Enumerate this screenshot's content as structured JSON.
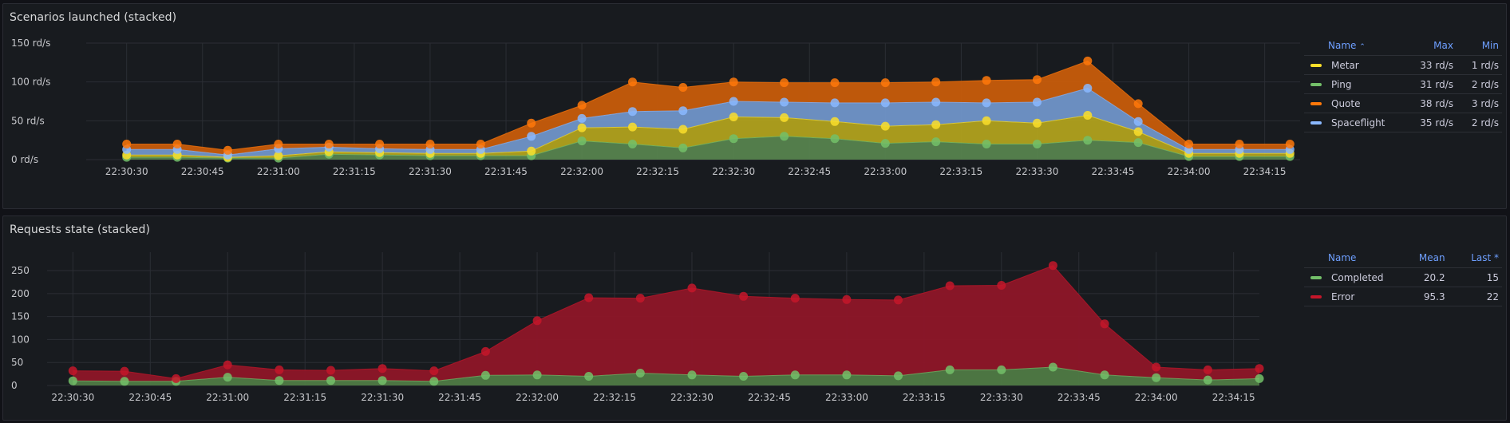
{
  "panel1": {
    "title": "Scenarios launched (stacked)",
    "legend": {
      "headers": [
        "Name",
        "Max",
        "Min"
      ],
      "sort_indicator": "⌃",
      "rows": [
        {
          "name": "Metar",
          "color": "#fade2a",
          "max": "33 rd/s",
          "min": "1 rd/s"
        },
        {
          "name": "Ping",
          "color": "#73bf69",
          "max": "31 rd/s",
          "min": "2 rd/s"
        },
        {
          "name": "Quote",
          "color": "#ff780a",
          "max": "38 rd/s",
          "min": "3 rd/s"
        },
        {
          "name": "Spaceflight",
          "color": "#8ab8ff",
          "max": "35 rd/s",
          "min": "2 rd/s"
        }
      ]
    }
  },
  "panel2": {
    "title": "Requests state (stacked)",
    "legend": {
      "headers": [
        "Name",
        "Mean",
        "Last *"
      ],
      "rows": [
        {
          "name": "Completed",
          "color": "#73bf69",
          "mean": "20.2",
          "last": "15"
        },
        {
          "name": "Error",
          "color": "#c4162a",
          "mean": "95.3",
          "last": "22"
        }
      ]
    }
  },
  "chart_data": [
    {
      "type": "area",
      "stacked": true,
      "title": "Scenarios launched (stacked)",
      "x_labels": [
        "22:30:30",
        "22:30:45",
        "22:31:00",
        "22:31:15",
        "22:31:30",
        "22:31:45",
        "22:32:00",
        "22:32:15",
        "22:32:30",
        "22:32:45",
        "22:33:00",
        "22:33:15",
        "22:33:30",
        "22:33:45",
        "22:34:00",
        "22:34:15"
      ],
      "ylim": [
        0,
        150
      ],
      "y_ticks": [
        0,
        50,
        100,
        150
      ],
      "y_tick_labels": [
        "0 rd/s",
        "50 rd/s",
        "100 rd/s",
        "150 rd/s"
      ],
      "x": [
        "22:30:30",
        "22:30:40",
        "22:30:50",
        "22:31:00",
        "22:31:10",
        "22:31:20",
        "22:31:30",
        "22:31:40",
        "22:31:50",
        "22:32:00",
        "22:32:10",
        "22:32:20",
        "22:32:30",
        "22:32:40",
        "22:32:50",
        "22:33:00",
        "22:33:10",
        "22:33:20",
        "22:33:30",
        "22:33:40",
        "22:33:50",
        "22:34:00",
        "22:34:10",
        "22:34:20"
      ],
      "series": [
        {
          "name": "Ping",
          "color": "#73bf69",
          "fill": "#56834e",
          "values": [
            3,
            3,
            2,
            2,
            7,
            6,
            5,
            5,
            5,
            24,
            20,
            15,
            27,
            30,
            27,
            21,
            23,
            20,
            20,
            25,
            22,
            4,
            4,
            4
          ]
        },
        {
          "name": "Metar",
          "color": "#fade2a",
          "fill": "#b0a11e",
          "values": [
            3,
            3,
            1,
            3,
            3,
            3,
            3,
            3,
            6,
            17,
            22,
            24,
            28,
            24,
            22,
            22,
            22,
            30,
            27,
            32,
            14,
            4,
            4,
            4
          ]
        },
        {
          "name": "Spaceflight",
          "color": "#8ab8ff",
          "fill": "#7095c9",
          "values": [
            7,
            7,
            3,
            9,
            6,
            5,
            5,
            5,
            19,
            12,
            20,
            24,
            20,
            20,
            24,
            30,
            29,
            23,
            27,
            35,
            13,
            5,
            5,
            5
          ]
        },
        {
          "name": "Quote",
          "color": "#ff780a",
          "fill": "#c75c0b",
          "values": [
            7,
            7,
            6,
            6,
            4,
            6,
            7,
            7,
            17,
            17,
            38,
            30,
            25,
            25,
            26,
            26,
            26,
            29,
            29,
            35,
            23,
            7,
            7,
            7
          ]
        }
      ]
    },
    {
      "type": "area",
      "stacked": true,
      "title": "Requests state (stacked)",
      "x_labels": [
        "22:30:30",
        "22:30:45",
        "22:31:00",
        "22:31:15",
        "22:31:30",
        "22:31:45",
        "22:32:00",
        "22:32:15",
        "22:32:30",
        "22:32:45",
        "22:33:00",
        "22:33:15",
        "22:33:30",
        "22:33:45",
        "22:34:00",
        "22:34:15"
      ],
      "ylim": [
        0,
        290
      ],
      "y_ticks": [
        0,
        50,
        100,
        150,
        200,
        250
      ],
      "y_tick_labels": [
        "0",
        "50",
        "100",
        "150",
        "200",
        "250"
      ],
      "x": [
        "22:30:30",
        "22:30:40",
        "22:30:50",
        "22:31:00",
        "22:31:10",
        "22:31:20",
        "22:31:30",
        "22:31:40",
        "22:31:50",
        "22:32:00",
        "22:32:10",
        "22:32:20",
        "22:32:30",
        "22:32:40",
        "22:32:50",
        "22:33:00",
        "22:33:10",
        "22:33:20",
        "22:33:30",
        "22:33:40",
        "22:33:50",
        "22:34:00",
        "22:34:10",
        "22:34:20"
      ],
      "series": [
        {
          "name": "Completed",
          "color": "#73bf69",
          "fill": "#4f7a45",
          "values": [
            10,
            9,
            9,
            18,
            11,
            11,
            11,
            9,
            22,
            23,
            20,
            27,
            23,
            20,
            23,
            23,
            21,
            34,
            34,
            40,
            23,
            17,
            12,
            15
          ]
        },
        {
          "name": "Error",
          "color": "#c4162a",
          "fill": "#8e1628",
          "values": [
            22,
            22,
            6,
            27,
            23,
            22,
            26,
            23,
            52,
            118,
            171,
            163,
            189,
            174,
            167,
            164,
            165,
            183,
            184,
            221,
            111,
            23,
            22,
            22
          ]
        }
      ]
    }
  ]
}
